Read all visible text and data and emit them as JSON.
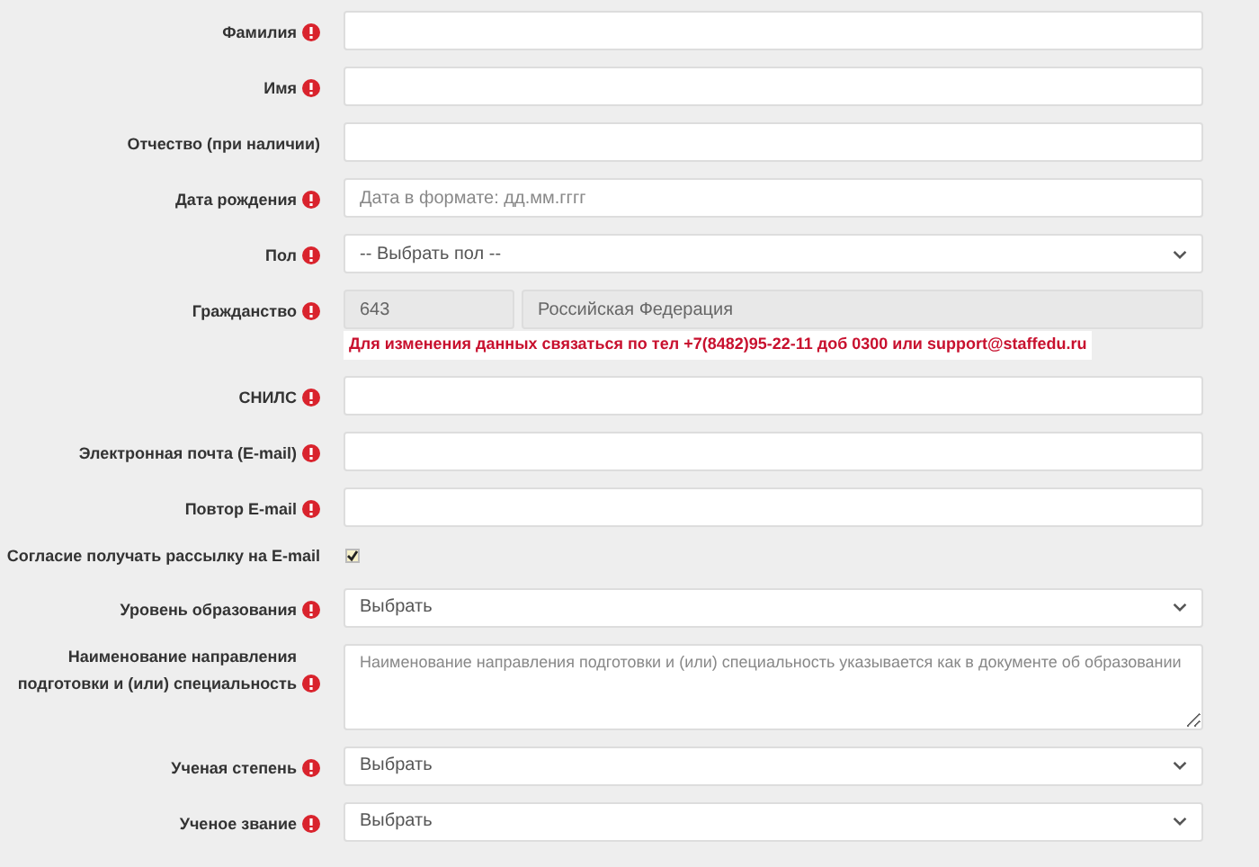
{
  "fields": [
    {
      "kind": "input",
      "label": "Фамилия",
      "required": true
    },
    {
      "kind": "input",
      "label": "Имя",
      "required": true
    },
    {
      "kind": "input",
      "label": "Отчество (при наличии)",
      "required": false
    },
    {
      "kind": "input",
      "label": "Дата рождения",
      "required": true,
      "placeholder": "Дата в формате: дд.мм.гггг"
    },
    {
      "kind": "select",
      "label": "Пол",
      "required": true,
      "value": "-- Выбрать пол --"
    },
    {
      "kind": "citizenship",
      "label": "Гражданство",
      "required": true,
      "code": "643",
      "country": "Российская Федерация",
      "note": "Для изменения данных связаться по тел +7(8482)95-22-11 доб 0300 или support@staffedu.ru"
    },
    {
      "kind": "input",
      "label": "СНИЛС",
      "required": true
    },
    {
      "kind": "input",
      "label": "Электронная почта (E-mail)",
      "required": true
    },
    {
      "kind": "input",
      "label": "Повтор E-mail",
      "required": true
    },
    {
      "kind": "checkbox",
      "label": "Согласие получать рассылку на E-mail",
      "required": false,
      "checked": true
    },
    {
      "kind": "select",
      "label": "Уровень образования",
      "required": true,
      "value": "Выбрать"
    },
    {
      "kind": "textarea",
      "label": "Наименование направления подготовки и (или) специальность",
      "required": true,
      "placeholder": "Наименование направления подготовки и (или) специальность указывается как в документе об образовании"
    },
    {
      "kind": "select",
      "label": "Ученая степень",
      "required": true,
      "value": "Выбрать"
    },
    {
      "kind": "select",
      "label": "Ученое звание",
      "required": true,
      "value": "Выбрать"
    }
  ]
}
